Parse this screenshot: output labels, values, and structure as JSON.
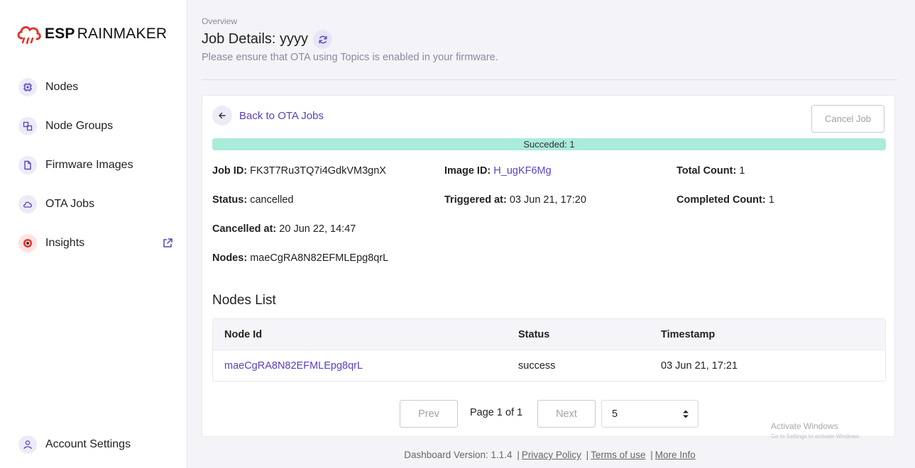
{
  "app": {
    "logo_bold": "ESP",
    "logo_light": "RAINMAKER",
    "brand_color": "#e8312a"
  },
  "sidebar": {
    "items": [
      {
        "label": "Nodes",
        "icon": "chip-icon"
      },
      {
        "label": "Node Groups",
        "icon": "node-groups-icon"
      },
      {
        "label": "Firmware Images",
        "icon": "file-icon"
      },
      {
        "label": "OTA Jobs",
        "icon": "cloud-icon"
      },
      {
        "label": "Insights",
        "icon": "insights-icon"
      }
    ],
    "account": {
      "label": "Account Settings",
      "icon": "user-icon"
    }
  },
  "header": {
    "breadcrumb": "Overview",
    "title": "Job Details: yyyy",
    "subtitle": "Please ensure that OTA using Topics is enabled in your firmware."
  },
  "card": {
    "back_label": "Back to OTA Jobs",
    "cancel_label": "Cancel Job",
    "progress": {
      "label": "Succeded: 1",
      "fraction": 1.0,
      "color": "#a8ecd9"
    },
    "fields": {
      "job_id": {
        "label": "Job ID:",
        "value": "FK3T7Ru3TQ7i4GdkVM3gnX"
      },
      "image_id": {
        "label": "Image ID:",
        "value": "H_ugKF6Mg"
      },
      "total_count": {
        "label": "Total Count:",
        "value": "1"
      },
      "status": {
        "label": "Status:",
        "value": "cancelled"
      },
      "triggered_at": {
        "label": "Triggered at:",
        "value": "03 Jun 21, 17:20"
      },
      "completed_count": {
        "label": "Completed Count:",
        "value": "1"
      },
      "cancelled_at": {
        "label": "Cancelled at:",
        "value": "20 Jun 22, 14:47"
      },
      "nodes": {
        "label": "Nodes:",
        "value": "maeCgRA8N82EFMLEpg8qrL"
      }
    },
    "nodes_list": {
      "title": "Nodes List",
      "columns": [
        "Node Id",
        "Status",
        "Timestamp"
      ],
      "rows": [
        {
          "node_id": "maeCgRA8N82EFMLEpg8qrL",
          "status": "success",
          "timestamp": "03 Jun 21, 17:21"
        }
      ]
    },
    "pagination": {
      "prev": "Prev",
      "page_text": "Page 1 of 1",
      "next": "Next",
      "page_size": "5"
    }
  },
  "watermark": {
    "line1": "Activate Windows",
    "line2": "Go to Settings to activate Windows."
  },
  "footer": {
    "version": "Dashboard Version: 1.1.4",
    "sep": "|",
    "privacy": "Privacy Policy",
    "terms": "Terms of use",
    "more": "More Info"
  },
  "accent_color": "#5b3fc2"
}
